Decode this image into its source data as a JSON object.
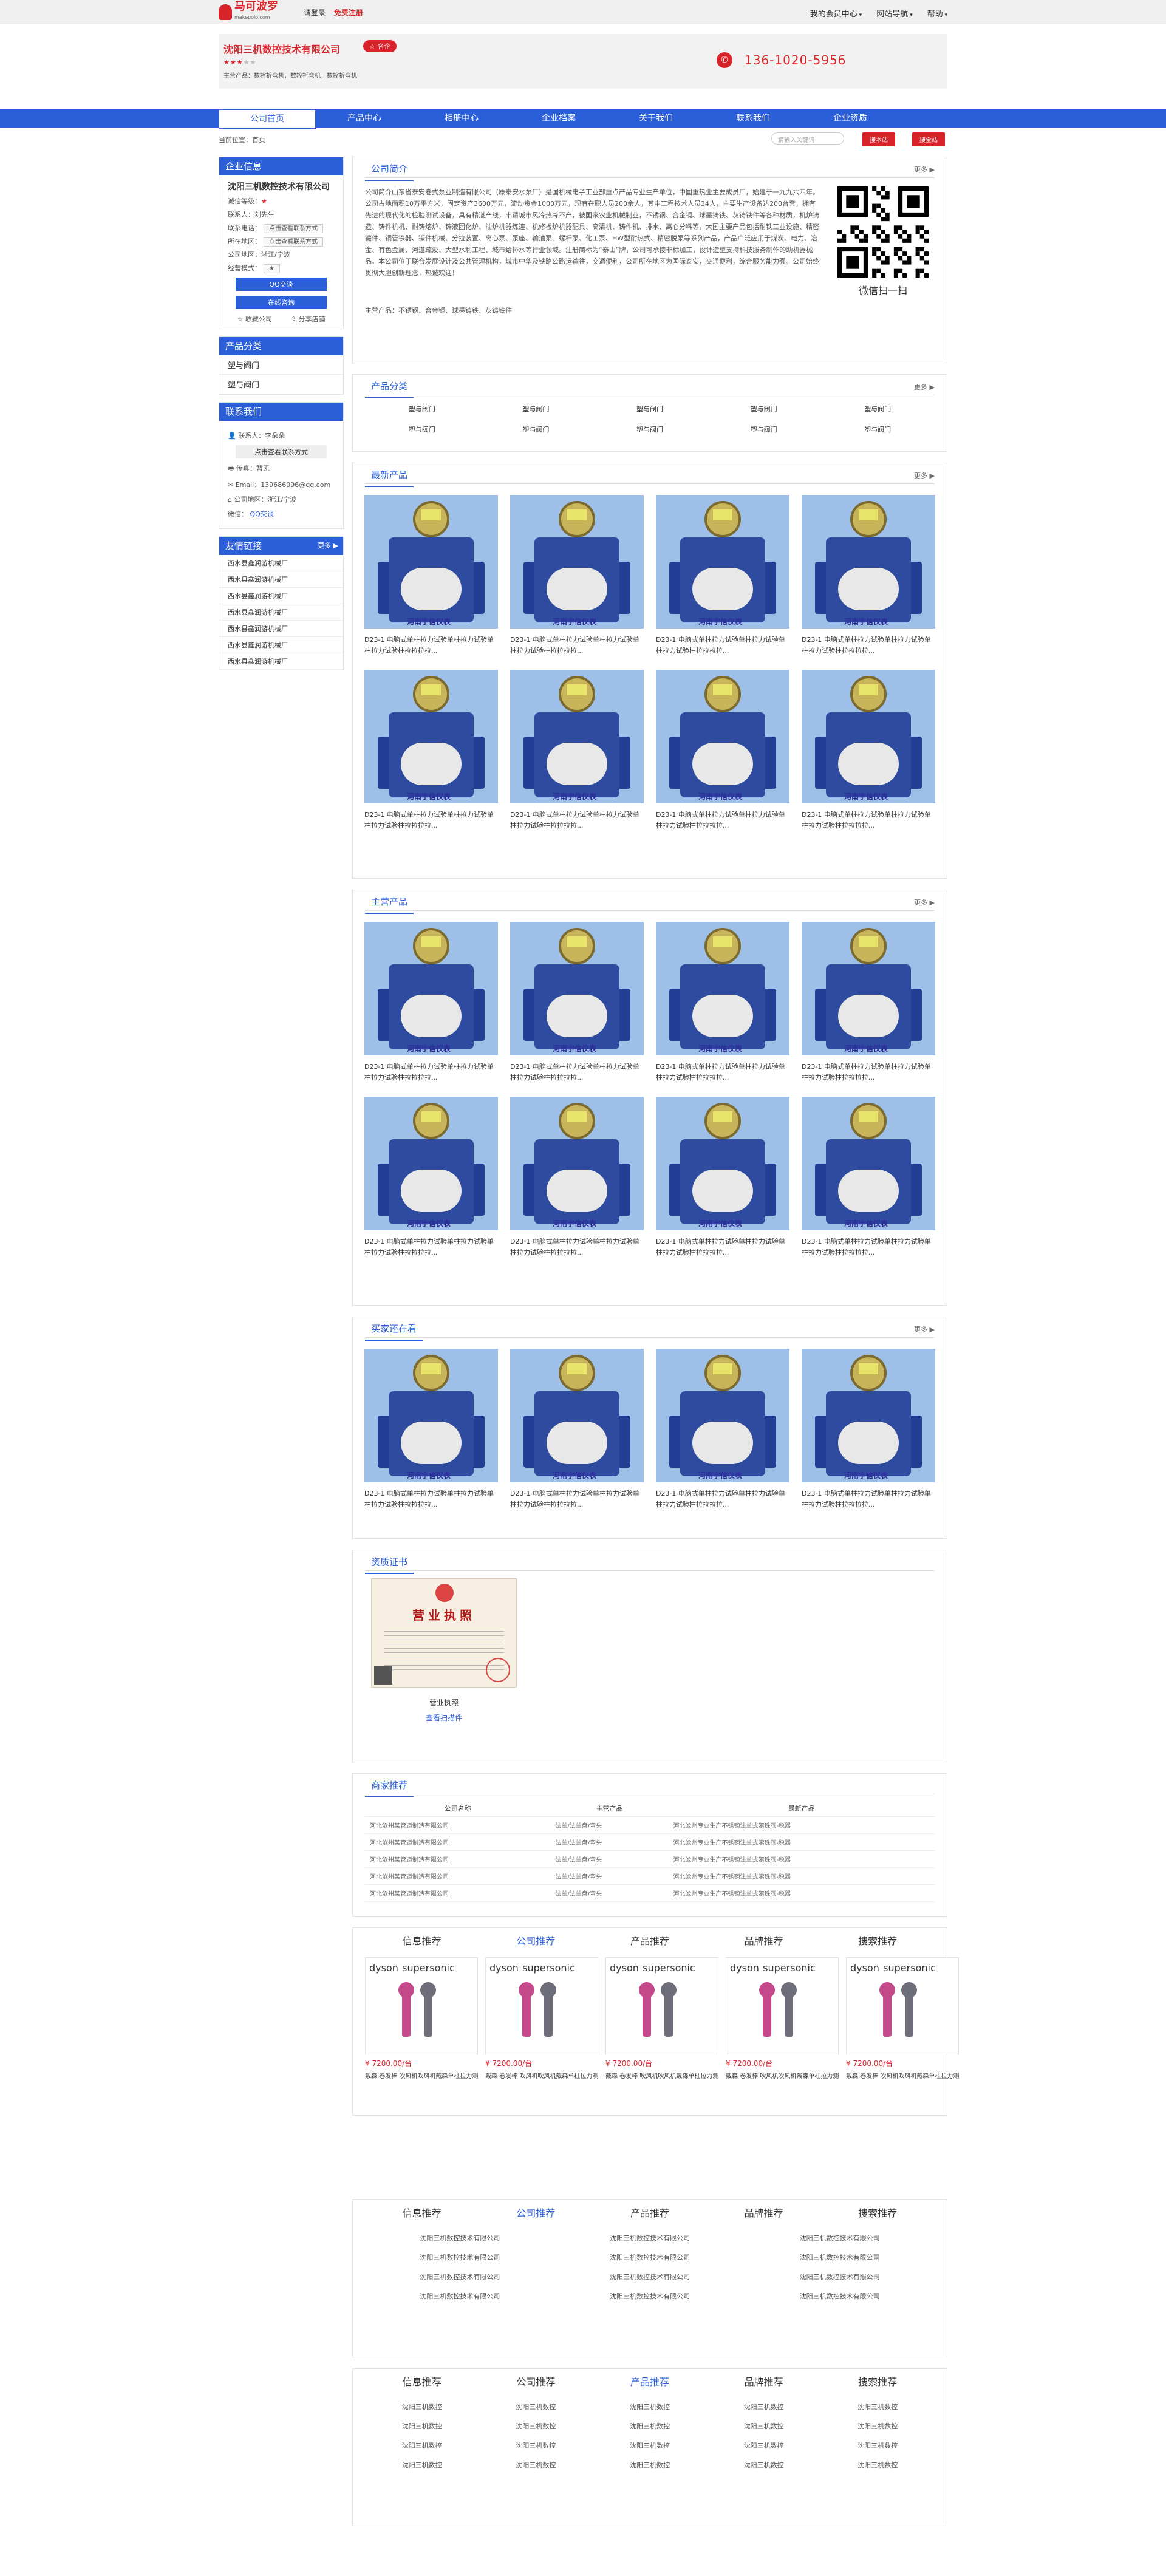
{
  "topbar": {
    "logo_text": "马可波罗",
    "logo_sub": "makepolo.com",
    "login": "请登录",
    "register": "免费注册",
    "menus": [
      "我的会员中心",
      "网站导航",
      "帮助"
    ]
  },
  "header": {
    "company": "沈阳三机数控技术有限公司",
    "badge": "☆ 名企",
    "stars": "★★★",
    "stars_off": "★★",
    "main_business": "主营产品：数控折弯机，数控折弯机，数控折弯机",
    "phone": "136-1020-5956"
  },
  "nav": [
    "公司首页",
    "产品中心",
    "相册中心",
    "企业档案",
    "关于我们",
    "联系我们",
    "企业资质"
  ],
  "crumb": {
    "position": "当前位置：首页",
    "search_placeholder": "请输入关键词",
    "btn_site": "搜本站",
    "btn_all": "搜全站"
  },
  "side": {
    "info_title": "企业信息",
    "company": "沈阳三机数控技术有限公司",
    "rows": [
      {
        "k": "诚信等级：",
        "v": "★"
      },
      {
        "k": "联系人：",
        "v": "刘先生"
      },
      {
        "k": "联系电话：",
        "v": "点击查看联系方式"
      },
      {
        "k": "所在地区：",
        "v": "点击查看联系方式"
      },
      {
        "k": "公司地区：",
        "v": "浙江/宁波"
      },
      {
        "k": "经营模式：",
        "v": "★"
      }
    ],
    "qq": "QQ交谈",
    "consult": "在线咨询",
    "fav": "收藏公司",
    "share": "分享店铺",
    "products_title": "产品分类",
    "products": [
      "塑与阀门",
      "塑与阀门"
    ],
    "contact_title": "联系我们",
    "contact_name": "联系人：李朵朵",
    "contact_btn": "点击查看联系方式",
    "addr": "传真：暂无",
    "email": "Email：139686096@qq.com",
    "area": "公司地区：浙江/宁波",
    "wechat": "微信：",
    "qqtalk": "QQ交谈",
    "links_title": "友情链接",
    "links_more": "更多 ▶",
    "links": [
      "西水县鑫润游机械厂",
      "西水县鑫润游机械厂",
      "西水县鑫润游机械厂",
      "西水县鑫润游机械厂",
      "西水县鑫润游机械厂",
      "西水县鑫润游机械厂",
      "西水县鑫润游机械厂"
    ]
  },
  "intro": {
    "title": "公司简介",
    "more": "更多 ▶",
    "text": "公司简介山东省泰安卷式泵业制造有限公司（原泰安水泵厂）是国机械电子工业部重点产品专业生产单位，中国重热业主要成员厂，始建于一九九六四年。公司占地面积10万平方米，固定资产3600万元，流动资金1000万元，现有在职人员200余人，其中工程技术人员34人，主要生产设备达200台套，拥有先进的现代化的检验测试设备，具有精湛产线，申请城市风冷热冷不产，被国家农业机械制业，不锈钢、合金钢、球墨铸铁、灰铸铁件等各种材质，机炉铸造、铸件机机、耐铸熔炉、铸液固化炉、油炉机器炼连、机修板炉机器配具、高清机、铸件机、排水、离心分料等，大国主要产品包括耐铁工业设施、精密锻件、铜管铁器、锻件机械、分拉装置、离心泵、泵座、输油泵、螺杆泵、化工泵、HW型耐热式、精密脱泵等系列产品，产品广泛应用于煤炭、电力、冶金、有色金属、河道疏浚、大型水利工程、城市给排水等行业领域。注册商标为“泰山”牌，公司可承接非标加工，设计造型支持科技服务制作的助机器械品。本公司位于联合发展设计及公共管理机构，城市中华及铁路公路运输往，交通便利，公司所在地区为国际泰安，交通便利，综合服务能力强。公司始终贯彻大胆创新理念，热诚欢迎！",
    "qr_label": "微信扫一扫",
    "biz": "主营产品：不锈钢、合金钢、球墨铸铁、灰铸铁件"
  },
  "cats": {
    "title": "产品分类",
    "more": "更多 ▶",
    "items": [
      "塑与阀门",
      "塑与阀门",
      "塑与阀门",
      "塑与阀门",
      "塑与阀门",
      "塑与阀门",
      "塑与阀门",
      "塑与阀门",
      "塑与阀门",
      "塑与阀门"
    ]
  },
  "product_name": "D23-1 电脑式单柱拉力试验单柱拉力试验单柱拉力试验柱拉拉拉拉...",
  "watermark": "河南宇信仪表",
  "sections": {
    "latest": "最新产品",
    "main": "主营产品",
    "viewing": "买家还在看",
    "certs": "资质证书",
    "merchants": "商家推荐",
    "more": "更多 ▶"
  },
  "cert": {
    "name": "营业执照",
    "link": "查看扫描件",
    "heading": "营业执照"
  },
  "merchants": {
    "headers": [
      "公司名称",
      "主营产品",
      "最新产品"
    ],
    "rows": [
      [
        "河北沧州某管道制造有限公司",
        "法兰/法兰盘/弯头",
        "河北沧州专业生产不锈钢法兰式滚珠阀-稳器"
      ],
      [
        "河北沧州某管道制造有限公司",
        "法兰/法兰盘/弯头",
        "河北沧州专业生产不锈钢法兰式滚珠阀-稳器"
      ],
      [
        "河北沧州某管道制造有限公司",
        "法兰/法兰盘/弯头",
        "河北沧州专业生产不锈钢法兰式滚珠阀-稳器"
      ],
      [
        "河北沧州某管道制造有限公司",
        "法兰/法兰盘/弯头",
        "河北沧州专业生产不锈钢法兰式滚珠阀-稳器"
      ],
      [
        "河北沧州某管道制造有限公司",
        "法兰/法兰盘/弯头",
        "河北沧州专业生产不锈钢法兰式滚珠阀-稳器"
      ]
    ]
  },
  "tabs": [
    "信息推荐",
    "公司推荐",
    "产品推荐",
    "品牌推荐",
    "搜索推荐"
  ],
  "ad": {
    "brand": "dyson",
    "model": "supersonic",
    "price": "¥ 7200.00/台",
    "name": "戴森 卷发棒 吹风机吹风机戴森单柱拉力测试机"
  },
  "company_links": [
    "沈阳三机数控技术有限公司",
    "沈阳三机数控技术有限公司",
    "沈阳三机数控技术有限公司",
    "沈阳三机数控技术有限公司",
    "沈阳三机数控技术有限公司",
    "沈阳三机数控技术有限公司",
    "沈阳三机数控技术有限公司",
    "沈阳三机数控技术有限公司",
    "沈阳三机数控技术有限公司",
    "沈阳三机数控技术有限公司",
    "沈阳三机数控技术有限公司",
    "沈阳三机数控技术有限公司"
  ],
  "short_links": [
    "沈阳三机数控",
    "沈阳三机数控",
    "沈阳三机数控",
    "沈阳三机数控",
    "沈阳三机数控",
    "沈阳三机数控",
    "沈阳三机数控",
    "沈阳三机数控",
    "沈阳三机数控",
    "沈阳三机数控",
    "沈阳三机数控",
    "沈阳三机数控",
    "沈阳三机数控",
    "沈阳三机数控",
    "沈阳三机数控",
    "沈阳三机数控",
    "沈阳三机数控",
    "沈阳三机数控",
    "沈阳三机数控",
    "沈阳三机数控"
  ]
}
